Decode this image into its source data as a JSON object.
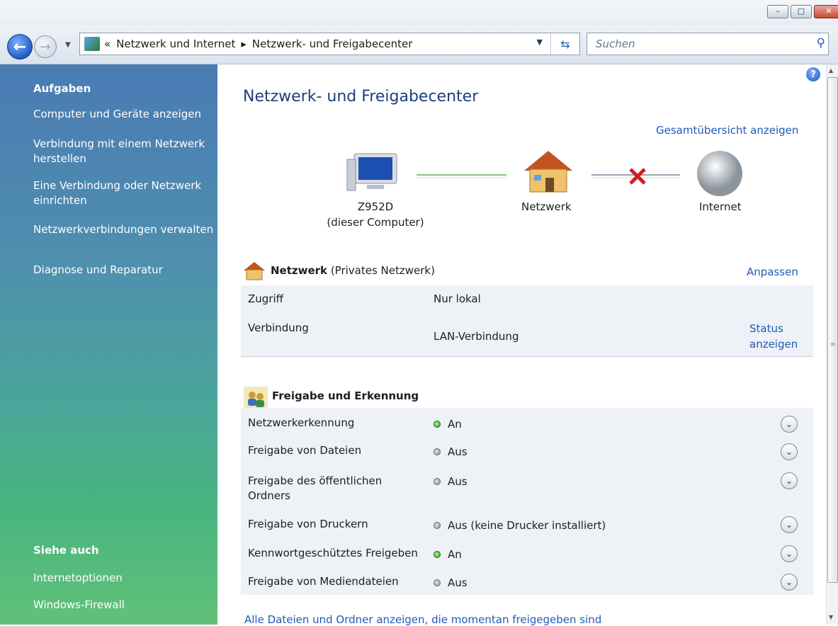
{
  "window": {
    "minimize": "–",
    "maximize": "□",
    "close": "✕"
  },
  "nav": {
    "back_icon": "back-arrow-icon",
    "forward_icon": "forward-arrow-icon",
    "address_prefix": "«",
    "breadcrumb": [
      "Netzwerk und Internet",
      "Netzwerk- und Freigabecenter"
    ],
    "separator": "▸",
    "search_placeholder": "Suchen"
  },
  "sidebar": {
    "tasks_heading": "Aufgaben",
    "tasks": [
      "Computer und Geräte anzeigen",
      "Verbindung mit einem Netzwerk herstellen",
      "Eine Verbindung oder Netzwerk einrichten",
      "Netzwerkverbindungen verwalten",
      "Diagnose und Reparatur"
    ],
    "see_also_heading": "Siehe auch",
    "see_also": [
      "Internetoptionen",
      "Windows-Firewall"
    ]
  },
  "main": {
    "title": "Netzwerk- und Freigabecenter",
    "overview_link": "Gesamtübersicht anzeigen",
    "map": {
      "computer_name": "Z952D",
      "computer_sub": "(dieser Computer)",
      "network_label": "Netzwerk",
      "internet_label": "Internet"
    },
    "network_section": {
      "name": "Netzwerk",
      "type": "(Privates Netzwerk)",
      "customize": "Anpassen",
      "access_label": "Zugriff",
      "access_value": "Nur lokal",
      "connection_label": "Verbindung",
      "connection_value": "LAN-Verbindung",
      "status_link_1": "Status",
      "status_link_2": "anzeigen"
    },
    "sharing": {
      "heading": "Freigabe und Erkennung",
      "rows": [
        {
          "label": "Netzwerkerkennung",
          "value": "An",
          "state": "on"
        },
        {
          "label": "Freigabe von Dateien",
          "value": "Aus",
          "state": "off"
        },
        {
          "label": "Freigabe des öffentlichen Ordners",
          "value": "Aus",
          "state": "off"
        },
        {
          "label": "Freigabe von Druckern",
          "value": "Aus (keine Drucker installiert)",
          "state": "off"
        },
        {
          "label": "Kennwortgeschütztes Freigeben",
          "value": "An",
          "state": "on"
        },
        {
          "label": "Freigabe von Mediendateien",
          "value": "Aus",
          "state": "off"
        }
      ],
      "footer_link": "Alle Dateien und Ordner anzeigen, die momentan freigegeben sind"
    }
  },
  "colors": {
    "link": "#1f5bb5",
    "title": "#1e3f7a",
    "sidebar_top": "#4a7bb4",
    "sidebar_bottom": "#61c178"
  }
}
